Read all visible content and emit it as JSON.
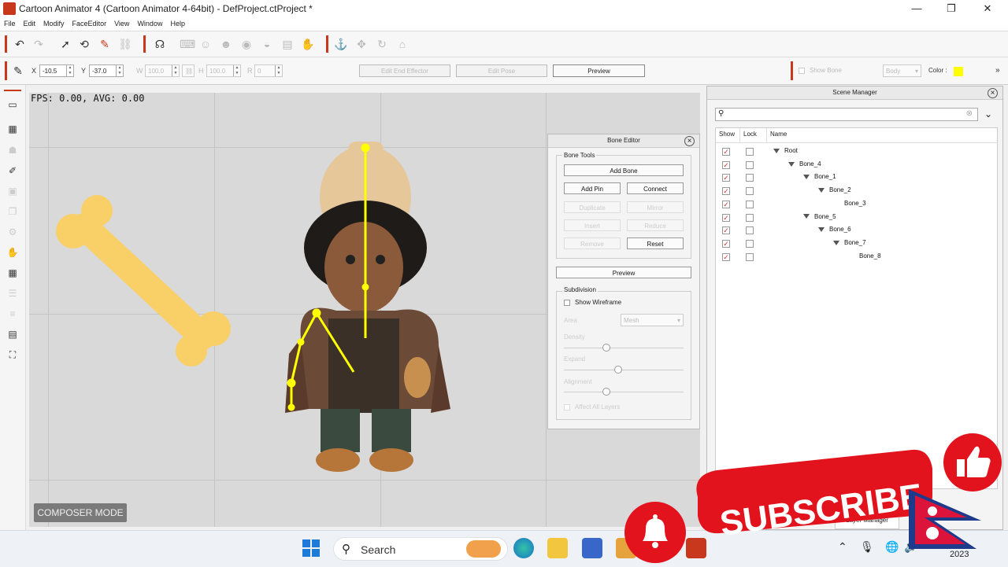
{
  "window": {
    "title": "Cartoon Animator 4  (Cartoon Animator 4-64bit) - DefProject.ctProject *",
    "minimize": "—",
    "maximize": "❐",
    "close": "✕"
  },
  "menu": [
    "File",
    "Edit",
    "Modify",
    "FaceEditor",
    "View",
    "Window",
    "Help"
  ],
  "toolbar2": {
    "x_label": "X",
    "x_value": "-10.5",
    "y_label": "Y",
    "y_value": "-37.0",
    "w_label": "W",
    "w_value": "100.0",
    "h_label": "H",
    "h_value": "100.0",
    "r_label": "R",
    "r_value": "0",
    "edit_end_effector": "Edit End Effector",
    "edit_pose": "Edit Pose",
    "preview": "Preview",
    "show_bone": "Show Bone",
    "body_select": "Body",
    "color_label": "Color :",
    "color_value": "#ffff00"
  },
  "stage": {
    "fps": "FPS: 0.00, AVG: 0.00",
    "composer_mode": "COMPOSER MODE"
  },
  "bone_editor": {
    "title": "Bone Editor",
    "bone_tools": "Bone Tools",
    "add_bone": "Add Bone",
    "add_pin": "Add Pin",
    "connect": "Connect",
    "duplicate": "Duplicate",
    "mirror": "Mirror",
    "insert": "Insert",
    "reduce": "Reduce",
    "remove": "Remove",
    "reset": "Reset",
    "preview": "Preview",
    "subdivision": "Subdivision",
    "show_wireframe": "Show Wireframe",
    "area_label": "Area",
    "area_value": "Mesh",
    "density": "Density",
    "expand": "Expand",
    "alignment": "Alignment",
    "affect_all_layers": "Affect All  Layers",
    "density_level": 0.35,
    "expand_level": 0.45,
    "alignment_level": 0.35
  },
  "scene_manager": {
    "title": "Scene Manager",
    "col_show": "Show",
    "col_lock": "Lock",
    "col_name": "Name",
    "rows": [
      {
        "name": "Root",
        "depth": 0,
        "expanded": true
      },
      {
        "name": "Bone_4",
        "depth": 1,
        "expanded": true
      },
      {
        "name": "Bone_1",
        "depth": 2,
        "expanded": true
      },
      {
        "name": "Bone_2",
        "depth": 3,
        "expanded": true
      },
      {
        "name": "Bone_3",
        "depth": 4,
        "expanded": false
      },
      {
        "name": "Bone_5",
        "depth": 2,
        "expanded": true
      },
      {
        "name": "Bone_6",
        "depth": 3,
        "expanded": true
      },
      {
        "name": "Bone_7",
        "depth": 4,
        "expanded": true
      },
      {
        "name": "Bone_8",
        "depth": 5,
        "expanded": false
      }
    ],
    "layer_manager_tab": "Layer Manager"
  },
  "taskbar": {
    "search_label": "Search",
    "year_fragment": "2023"
  },
  "overlay": {
    "subscribe_text": "SUBSCRIBE",
    "accent": "#e3131d"
  },
  "icons": {
    "check": "✓",
    "undo": "↶",
    "redo": "↷"
  }
}
